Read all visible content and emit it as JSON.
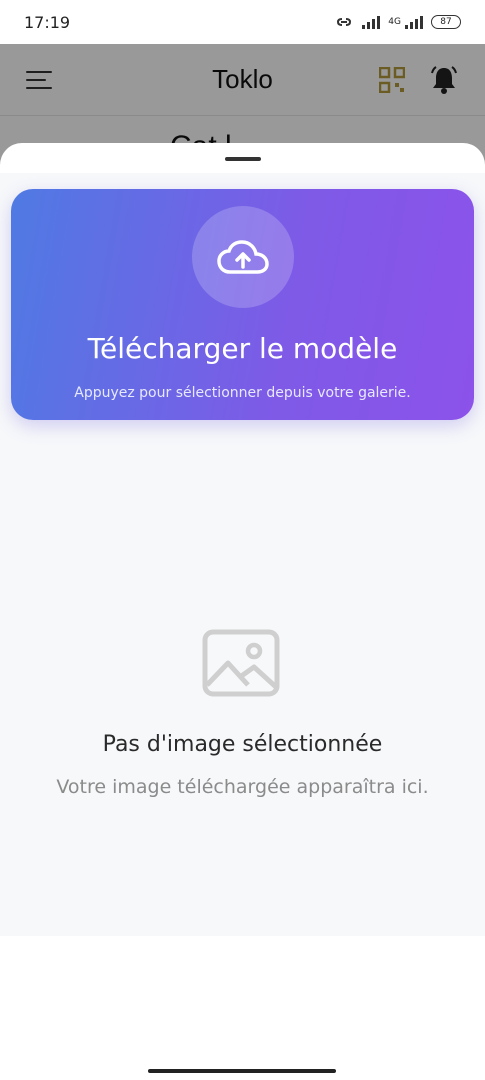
{
  "status_bar": {
    "time": "17:19",
    "network_type": "4G",
    "battery": "87"
  },
  "app_bar": {
    "title": "Toklo",
    "subtitle_peek": "Cat l"
  },
  "upload_card": {
    "title": "Télécharger le modèle",
    "hint": "Appuyez pour sélectionner depuis votre galerie.",
    "icon": "cloud-upload-icon",
    "gradient_start": "#4f7ae3",
    "gradient_end": "#8c52ea"
  },
  "empty_state": {
    "icon": "image-placeholder-icon",
    "title": "Pas d'image sélectionnée",
    "hint": "Votre image téléchargée apparaîtra ici."
  },
  "colors": {
    "qr_accent": "#b39a3c",
    "overlay": "rgba(0,0,0,0.40)"
  }
}
